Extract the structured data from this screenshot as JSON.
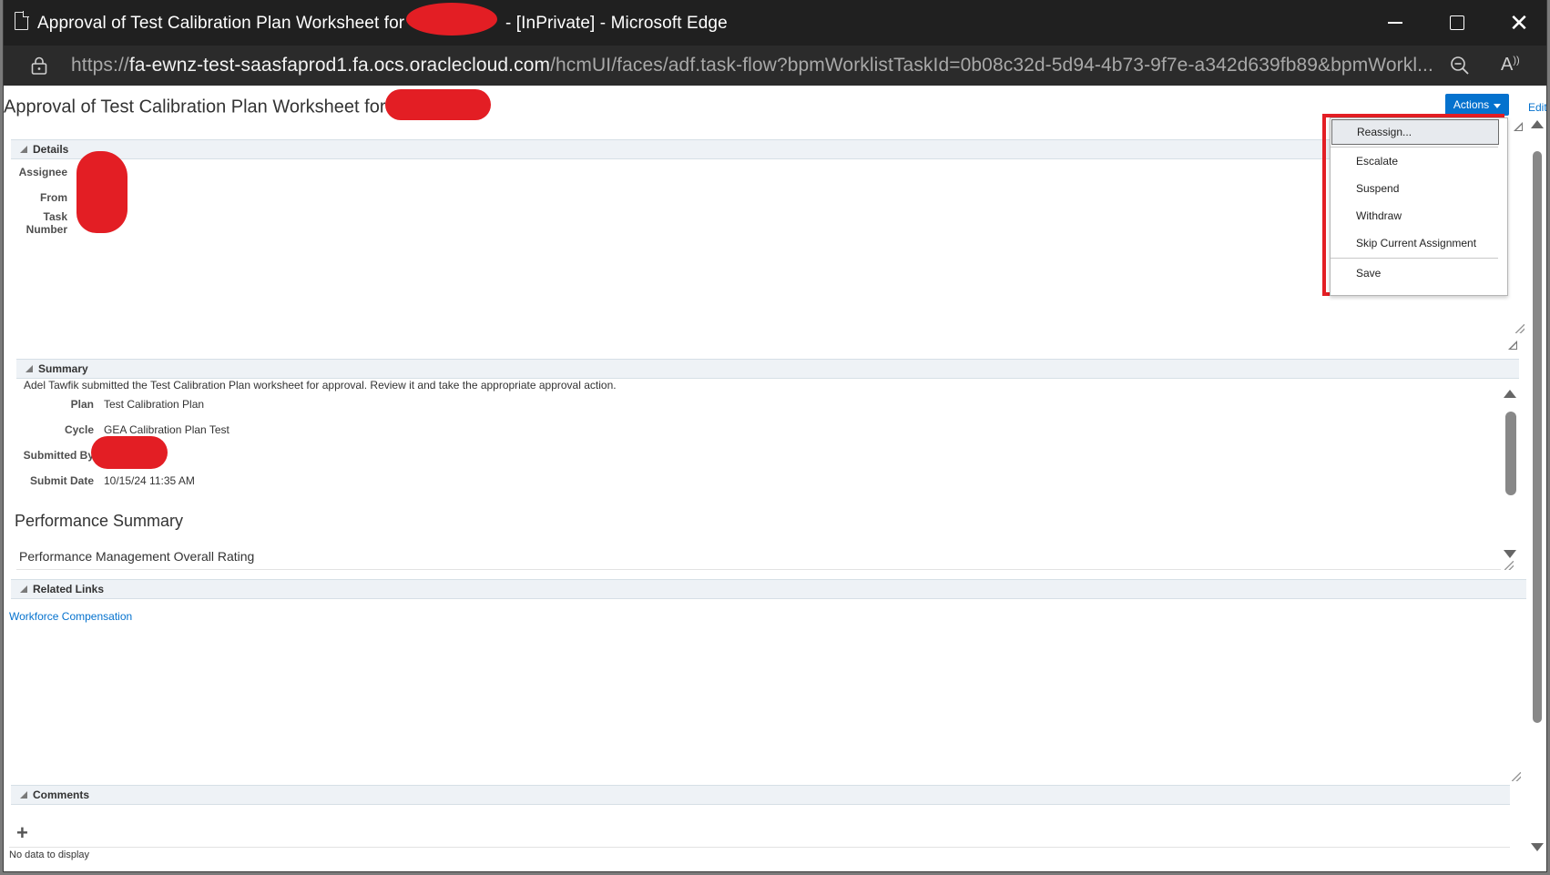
{
  "window": {
    "title_prefix": "Approval of Test Calibration Plan Worksheet for",
    "title_suffix": "- [InPrivate] - Microsoft Edge"
  },
  "address": {
    "scheme": "https://",
    "host": "fa-ewnz-test-saasfaprod1.fa.ocs.oraclecloud.com",
    "path": "/hcmUI/faces/adf.task-flow?bpmWorklistTaskId=0b08c32d-5d94-4b73-9f7e-a342d639fb89&bpmWorkl..."
  },
  "page": {
    "title": "Approval of Test Calibration Plan Worksheet for",
    "actions_label": "Actions",
    "edit_label": "Edit"
  },
  "details": {
    "header": "Details",
    "assignee_label": "Assignee",
    "from_label": "From",
    "task_number_label_1": "Task",
    "task_number_label_2": "Number"
  },
  "summary": {
    "header": "Summary",
    "description": "Adel Tawfik submitted the Test Calibration Plan worksheet for approval. Review it and take the appropriate approval action.",
    "plan_label": "Plan",
    "plan_value": "Test Calibration Plan",
    "cycle_label": "Cycle",
    "cycle_value": "GEA Calibration Plan Test",
    "submitted_by_label": "Submitted By",
    "submit_date_label": "Submit Date",
    "submit_date_value": "10/15/24 11:35 AM",
    "perf_summary_title": "Performance Summary",
    "perf_rating_label": "Performance Management Overall Rating"
  },
  "related_links": {
    "header": "Related Links",
    "link": "Workforce Compensation"
  },
  "comments": {
    "header": "Comments",
    "add_symbol": "+",
    "empty_text": "No data to display"
  },
  "actions_menu": {
    "items": [
      "Reassign...",
      "Escalate",
      "Suspend",
      "Withdraw",
      "Skip Current Assignment",
      "Save"
    ]
  },
  "colors": {
    "accent": "#0572ce",
    "redaction": "#e31e24",
    "titlebar": "#202020",
    "addressbar": "#2b2b2b"
  }
}
